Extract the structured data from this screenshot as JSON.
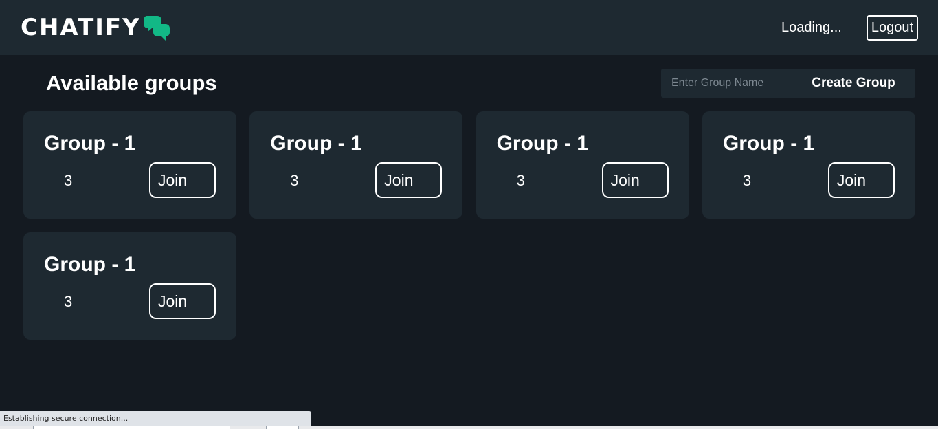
{
  "app": {
    "logo_text": "CHATIFY",
    "logo_icon": "chat-bubbles-icon",
    "accent_color": "#12b886"
  },
  "header": {
    "status_text": "Loading...",
    "logout_label": "Logout"
  },
  "main": {
    "title": "Available groups",
    "create_group": {
      "input_placeholder": "Enter Group Name",
      "input_value": "",
      "button_label": "Create Group"
    },
    "groups": [
      {
        "name": "Group - 1",
        "count": "3",
        "join_label": "Join"
      },
      {
        "name": "Group - 1",
        "count": "3",
        "join_label": "Join"
      },
      {
        "name": "Group - 1",
        "count": "3",
        "join_label": "Join"
      },
      {
        "name": "Group - 1",
        "count": "3",
        "join_label": "Join"
      },
      {
        "name": "Group - 1",
        "count": "3",
        "join_label": "Join"
      }
    ]
  },
  "browser": {
    "status_text": "Establishing secure connection..."
  }
}
